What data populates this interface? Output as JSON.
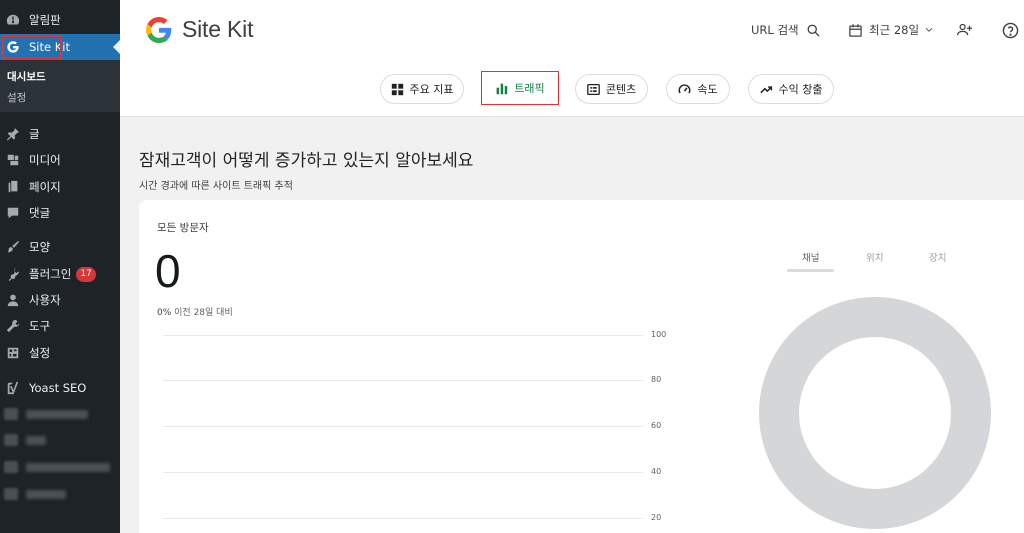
{
  "sidebar": {
    "items": [
      {
        "label": "알림판",
        "icon": "dashboard-icon"
      },
      {
        "label": "Site Kit",
        "icon": "google-g-icon"
      },
      {
        "label": "글",
        "icon": "pin-icon"
      },
      {
        "label": "미디어",
        "icon": "media-icon"
      },
      {
        "label": "페이지",
        "icon": "page-icon"
      },
      {
        "label": "댓글",
        "icon": "comment-icon"
      },
      {
        "label": "모양",
        "icon": "brush-icon"
      },
      {
        "label": "플러그인",
        "icon": "plugin-icon",
        "badge": "17"
      },
      {
        "label": "사용자",
        "icon": "user-icon"
      },
      {
        "label": "도구",
        "icon": "wrench-icon"
      },
      {
        "label": "설정",
        "icon": "settings-icon"
      },
      {
        "label": "Yoast SEO",
        "icon": "yoast-icon"
      }
    ],
    "submenu": [
      "대시보드",
      "설정"
    ]
  },
  "header": {
    "title": "Site Kit",
    "url_search": "URL 검색",
    "date_range": "최근 28일"
  },
  "tabs": [
    "주요 지표",
    "트래픽",
    "콘텐츠",
    "속도",
    "수익 창출"
  ],
  "main": {
    "heading": "잠재고객이 어떻게 증가하고 있는지 알아보세요",
    "subheading": "시간 경과에 따른 사이트 트래픽 추적",
    "card": {
      "label": "모든 방문자",
      "value": "0",
      "change": "0%",
      "change_text": "이전 28일 대비",
      "y_ticks": [
        "100",
        "80",
        "60",
        "40",
        "20"
      ],
      "dimension_tabs": [
        "채널",
        "위치",
        "장치"
      ]
    }
  },
  "colors": {
    "sidebar_bg": "#1d2327",
    "active_blue": "#2271b1",
    "highlight_red": "#e0323a",
    "traffic_green": "#108043",
    "donut_gray": "#d4d6d8"
  }
}
